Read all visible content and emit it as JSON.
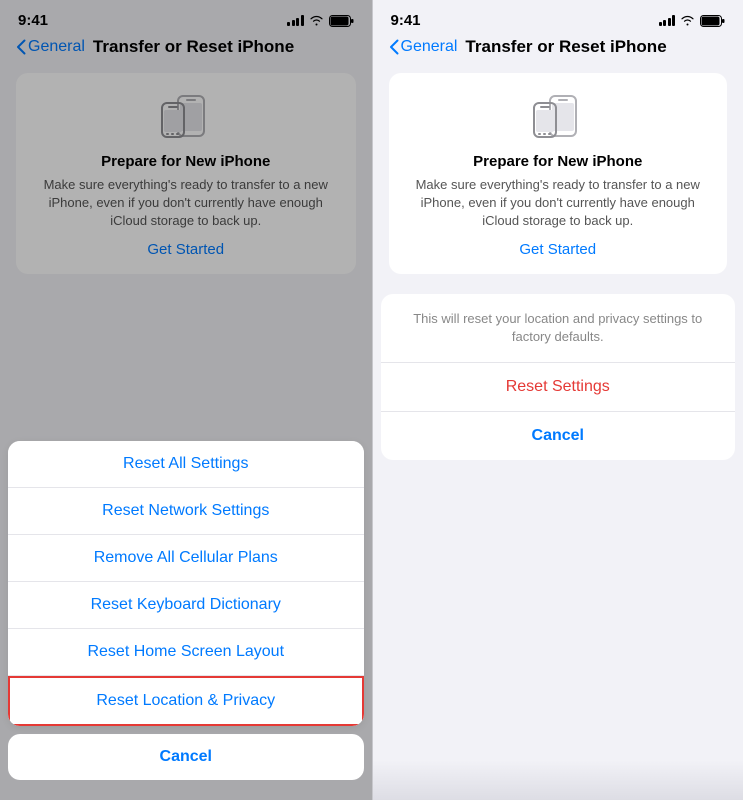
{
  "left_panel": {
    "status": {
      "time": "9:41"
    },
    "nav": {
      "back_label": "General",
      "title": "Transfer or Reset iPhone"
    },
    "prepare_card": {
      "title": "Prepare for New iPhone",
      "description": "Make sure everything's ready to transfer to a new iPhone, even if you don't currently have enough iCloud storage to back up.",
      "cta": "Get Started"
    },
    "reset_options": [
      {
        "label": "Reset All Settings"
      },
      {
        "label": "Reset Network Settings"
      },
      {
        "label": "Remove All Cellular Plans"
      },
      {
        "label": "Reset Keyboard Dictionary"
      },
      {
        "label": "Reset Home Screen Layout"
      },
      {
        "label": "Reset Location & Privacy",
        "highlighted": true
      }
    ],
    "cancel": "Cancel"
  },
  "right_panel": {
    "status": {
      "time": "9:41"
    },
    "nav": {
      "back_label": "General",
      "title": "Transfer or Reset iPhone"
    },
    "prepare_card": {
      "title": "Prepare for New iPhone",
      "description": "Make sure everything's ready to transfer to a new iPhone, even if you don't currently have enough iCloud storage to back up.",
      "cta": "Get Started"
    },
    "confirm_dialog": {
      "message": "This will reset your location and privacy settings to factory defaults.",
      "reset_label": "Reset Settings",
      "cancel_label": "Cancel"
    }
  },
  "colors": {
    "blue": "#007aff",
    "red": "#e53935",
    "highlight_border": "#e53935"
  }
}
